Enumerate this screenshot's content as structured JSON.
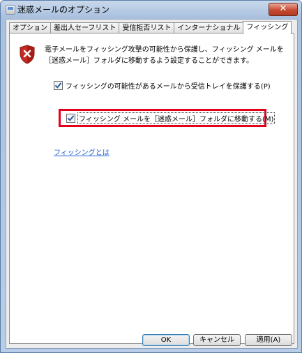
{
  "window": {
    "title": "迷惑メールのオプション",
    "close_symbol": "✕"
  },
  "tabs": [
    {
      "label": "オプション",
      "active": false
    },
    {
      "label": "差出人セーフリスト",
      "active": false
    },
    {
      "label": "受信拒否リスト",
      "active": false
    },
    {
      "label": "インターナショナル",
      "active": false
    },
    {
      "label": "フィッシング",
      "active": true
    }
  ],
  "panel": {
    "description": "電子メールをフィッシング攻撃の可能性から保護し、フィッシング メールを［迷惑メール］フォルダに移動するよう設定することができます。",
    "option_protect": {
      "label": "フィッシングの可能性があるメールから受信トレイを保護する(P)",
      "checked": true
    },
    "option_move": {
      "label": "フィッシング メールを［迷惑メール］フォルダに移動する(M)",
      "checked": true
    },
    "link": "フィッシングとは",
    "highlight_color": "#e3001b"
  },
  "buttons": {
    "ok": "OK",
    "cancel": "キャンセル",
    "apply": "適用(A)"
  }
}
